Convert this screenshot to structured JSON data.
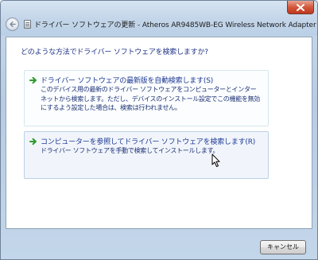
{
  "window": {
    "title": "ドライバー ソフトウェアの更新 - Atheros AR9485WB-EG Wireless Network Adapter"
  },
  "prompt": "どのような方法でドライバー ソフトウェアを検索しますか?",
  "options": [
    {
      "title": "ドライバー ソフトウェアの最新版を自動検索します(S)",
      "description_lines": [
        "このデバイス用の最新のドライバー ソフトウェアをコンピューターとインター",
        "ネットから検索します。ただし、デバイスのインストール設定でこの機能を無効",
        "にするよう設定した場合は、検索は行われません。"
      ]
    },
    {
      "title": "コンピューターを参照してドライバー ソフトウェアを検索します(R)",
      "description_lines": [
        "ドライバー ソフトウェアを手動で検索してインストールします。"
      ]
    }
  ],
  "footer": {
    "cancel_label": "キャンセル"
  },
  "icons": {
    "close": "close-icon",
    "back": "back-arrow-icon",
    "title": "driver-document-icon",
    "option_arrow": "green-arrow-icon",
    "cursor": "mouse-pointer-icon"
  },
  "colors": {
    "link_text": "#1d3994",
    "arrow_green": "#2e9a2e",
    "close_button": "#c0381c"
  }
}
